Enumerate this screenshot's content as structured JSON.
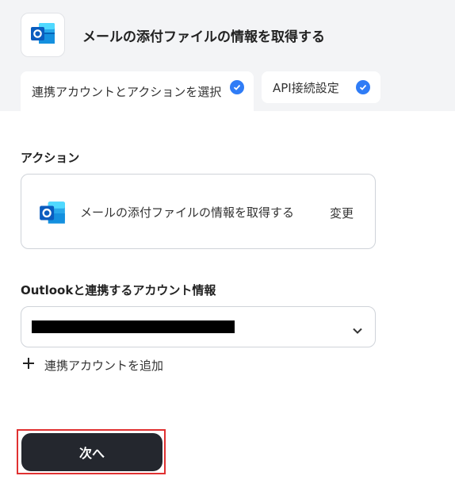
{
  "header": {
    "title": "メールの添付ファイルの情報を取得する",
    "app_icon": "outlook-icon"
  },
  "tabs": [
    {
      "label": "連携アカウントとアクションを選択",
      "completed": true
    },
    {
      "label": "API接続設定",
      "completed": true
    }
  ],
  "action_section": {
    "label": "アクション",
    "action_name": "メールの添付ファイルの情報を取得する",
    "change_label": "変更"
  },
  "account_section": {
    "label": "Outlookと連携するアカウント情報",
    "selected_value_masked": true,
    "add_account_label": "連携アカウントを追加"
  },
  "footer": {
    "next_label": "次へ"
  },
  "colors": {
    "accent": "#2f7cf6",
    "header_bg": "#f3f4f6",
    "primary_button": "#24272e",
    "highlight_border": "#e03131"
  }
}
